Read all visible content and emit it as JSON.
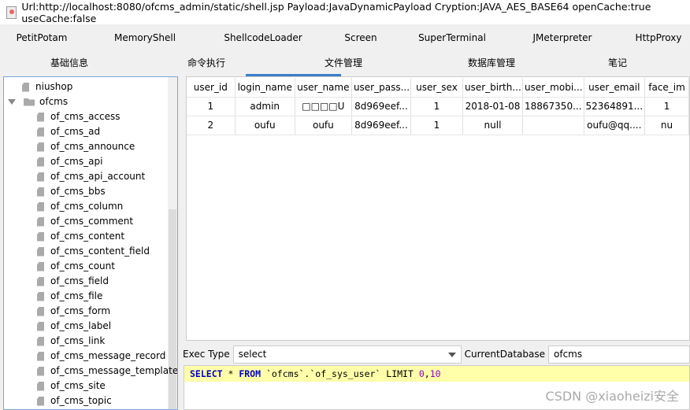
{
  "window": {
    "title": "Url:http://localhost:8080/ofcms_admin/static/shell.jsp Payload:JavaDynamicPayload Cryption:JAVA_AES_BASE64 openCache:true useCache:false"
  },
  "plugin_tabs": [
    "PetitPotam",
    "MemoryShell",
    "ShellcodeLoader",
    "Screen",
    "SuperTerminal",
    "JMeterpreter",
    "HttpProxy"
  ],
  "main_tabs": [
    {
      "label": "基础信息"
    },
    {
      "label": "命令执行"
    },
    {
      "label": "文件管理"
    },
    {
      "label": "数据库管理",
      "active": true
    },
    {
      "label": "笔记"
    }
  ],
  "tree": {
    "databases": [
      {
        "name": "niushop"
      },
      {
        "name": "ofcms",
        "expanded": true
      }
    ],
    "tables": [
      "of_cms_access",
      "of_cms_ad",
      "of_cms_announce",
      "of_cms_api",
      "of_cms_api_account",
      "of_cms_bbs",
      "of_cms_column",
      "of_cms_comment",
      "of_cms_content",
      "of_cms_content_field",
      "of_cms_count",
      "of_cms_field",
      "of_cms_file",
      "of_cms_form",
      "of_cms_label",
      "of_cms_link",
      "of_cms_message_record",
      "of_cms_message_template",
      "of_cms_site",
      "of_cms_topic"
    ]
  },
  "result_table": {
    "columns": [
      "user_id",
      "login_name",
      "user_name",
      "user_pass...",
      "user_sex",
      "user_birth...",
      "user_mobi...",
      "user_email",
      "face_im"
    ],
    "rows": [
      [
        "1",
        "admin",
        "□□□□U",
        "8d969eef...",
        "1",
        "2018-01-08",
        "18867350...",
        "52364891...",
        "1"
      ],
      [
        "2",
        "oufu",
        "oufu",
        "8d969eef...",
        "1",
        "null",
        "",
        "oufu@qq....",
        "nu"
      ]
    ]
  },
  "exec": {
    "label": "Exec Type",
    "value": "select",
    "db_label": "CurrentDatabase",
    "db_value": "ofcms"
  },
  "query": {
    "kw1": "SELECT",
    "star": " * ",
    "kw2": "FROM",
    "mid": " `ofcms`.`of_sys_user` LIMIT ",
    "n1": "0",
    ",": ",",
    "n2": "10"
  },
  "watermark": "CSDN @xiaoheizi安全",
  "colors": {
    "accent": "#3c7fc6",
    "highlight": "#ffffaa"
  }
}
